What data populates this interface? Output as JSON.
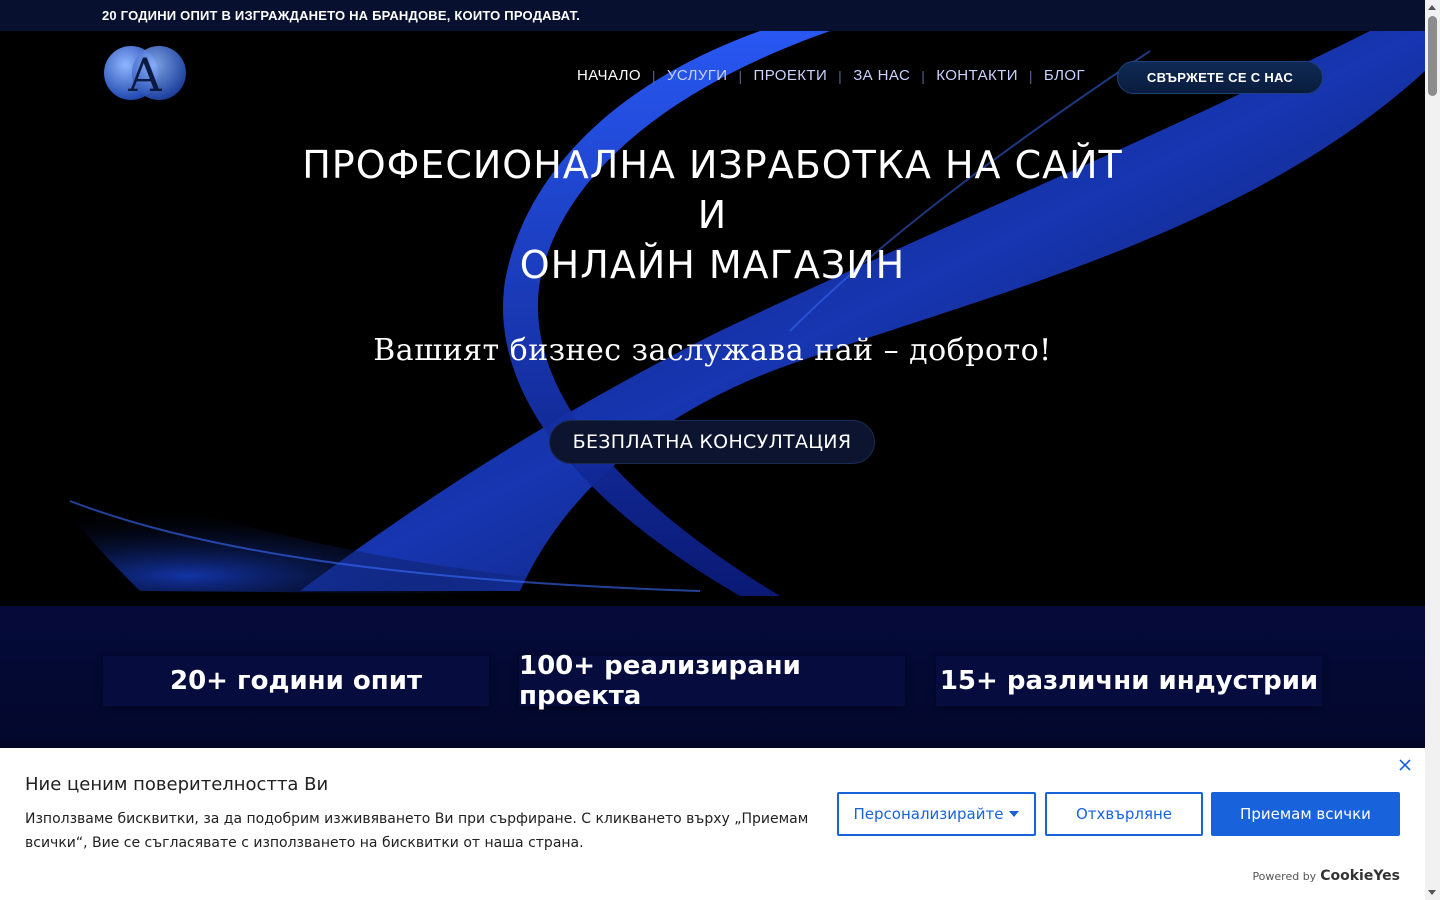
{
  "topbar": {
    "text": "20 ГОДИНИ ОПИТ В ИЗГРАЖДАНЕТО НА БРАНДОВЕ, КОИТО ПРОДАВАТ."
  },
  "logo": {
    "letter": "A"
  },
  "nav": {
    "items": [
      "НАЧАЛО",
      "УСЛУГИ",
      "ПРОЕКТИ",
      "ЗА НАС",
      "КОНТАКТИ",
      "БЛОГ"
    ],
    "separator": "|",
    "cta": "СВЪРЖЕТЕ СЕ С НАС"
  },
  "hero": {
    "line1": "ПРОФЕСИОНАЛНА ИЗРАБОТКА НА САЙТ",
    "line2": "И",
    "line3": "ОНЛАЙН МАГАЗИН",
    "subtitle": "Вашият бизнес заслужава най – доброто!",
    "cta": "БЕЗПЛАТНА КОНСУЛТАЦИЯ"
  },
  "stats": [
    "20+ години опит",
    "100+ реализирани проекта",
    "15+ различни индустрии"
  ],
  "cookie": {
    "title": "Ние ценим поверителността Ви",
    "description": "Използваме бисквитки, за да подобрим изживяването Ви при сърфиране. С кликването върху „Приемам всички“, Вие се съгласявате с използването на бисквитки от наша страна.",
    "customize": "Персонализирайте",
    "reject": "Отхвърляне",
    "accept": "Приемам всички",
    "powered_by": "Powered by",
    "brand": "CookieYes"
  },
  "colors": {
    "accent": "#1863dc",
    "nav_bg": "#07102e",
    "stats_bg": "#050a3a"
  }
}
